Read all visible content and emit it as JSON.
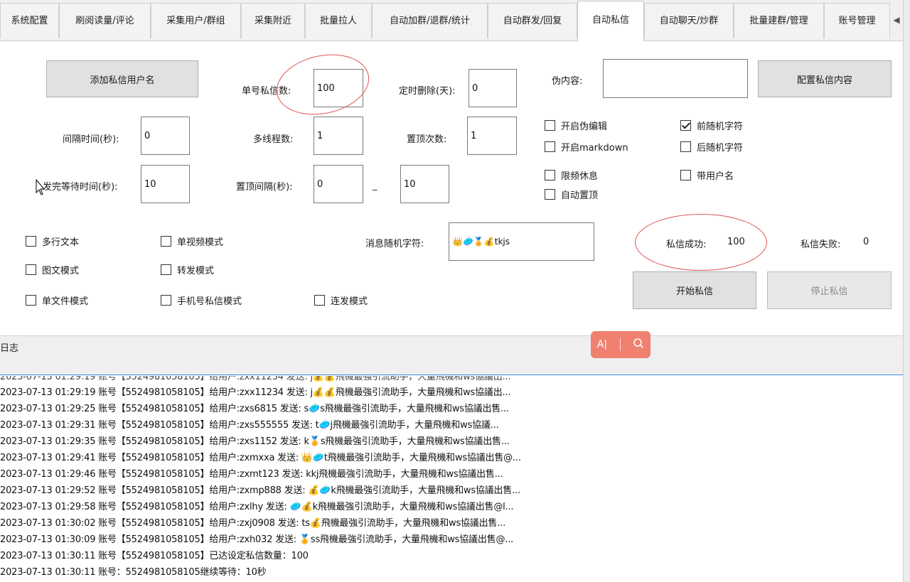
{
  "tabs": [
    {
      "label": "系统配置"
    },
    {
      "label": "刷阅读量/评论"
    },
    {
      "label": "采集用户/群组"
    },
    {
      "label": "采集附近"
    },
    {
      "label": "批量拉人"
    },
    {
      "label": "自动加群/退群/统计"
    },
    {
      "label": "自动群发/回复"
    },
    {
      "label": "自动私信"
    },
    {
      "label": "自动聊天/炒群"
    },
    {
      "label": "批量建群/管理"
    },
    {
      "label": "账号管理"
    }
  ],
  "active_tab": "自动私信",
  "form": {
    "add_user_button": "添加私信用户名",
    "per_account_label": "单号私信数:",
    "per_account_value": "100",
    "timed_delete_label": "定时删除(天):",
    "timed_delete_value": "0",
    "fake_content_label": "伪内容:",
    "fake_content_value": "",
    "config_content_button": "配置私信内容",
    "interval_label": "间隔时间(秒):",
    "interval_value": "0",
    "threads_label": "多线程数:",
    "threads_value": "1",
    "pin_count_label": "置顶次数:",
    "pin_count_value": "1",
    "wait_label": "发完等待时间(秒):",
    "wait_value": "10",
    "pin_interval_label": "置顶间隔(秒):",
    "pin_interval_min": "0",
    "pin_interval_dash": "_",
    "pin_interval_max": "10",
    "random_chars_label": "消息随机字符:",
    "random_chars_value": "👑🥏🏅💰tkjs",
    "success_label": "私信成功:",
    "success_value": "100",
    "fail_label": "私信失败:",
    "fail_value": "0",
    "start_button": "开始私信",
    "stop_button": "停止私信"
  },
  "checkboxes": {
    "fake_edit": {
      "label": "开启伪编辑",
      "checked": false
    },
    "markdown": {
      "label": "开启markdown",
      "checked": false
    },
    "rate_limit_rest": {
      "label": "限频休息",
      "checked": false
    },
    "auto_pin": {
      "label": "自动置顶",
      "checked": false
    },
    "prefix_random": {
      "label": "前随机字符",
      "checked": true
    },
    "suffix_random": {
      "label": "后随机字符",
      "checked": false
    },
    "with_username": {
      "label": "带用户名",
      "checked": false
    },
    "multiline_text": {
      "label": "多行文本",
      "checked": false
    },
    "image_text_mode": {
      "label": "图文模式",
      "checked": false
    },
    "single_file_mode": {
      "label": "单文件模式",
      "checked": false
    },
    "single_video_mode": {
      "label": "单视频模式",
      "checked": false
    },
    "forward_mode": {
      "label": "转发模式",
      "checked": false
    },
    "phone_dm_mode": {
      "label": "手机号私信模式",
      "checked": false
    },
    "burst_mode": {
      "label": "连发模式",
      "checked": false
    }
  },
  "log": {
    "title": "日志",
    "lines": [
      "2023-07-13 01:29:19 账号【5524981058105】给用户:zxx11234 发送: j💰💰飛機最強引流助手，大量飛機和ws協議出...",
      "2023-07-13 01:29:25 账号【5524981058105】给用户:zxs6815 发送: s🥏s飛機最強引流助手，大量飛機和ws協議出售...",
      "2023-07-13 01:29:31 账号【5524981058105】给用户:zxs555555 发送: t🥏j飛機最強引流助手，大量飛機和ws協議...",
      "2023-07-13 01:29:35 账号【5524981058105】给用户:zxs1152 发送: k🏅s飛機最強引流助手，大量飛機和ws協議出售...",
      "2023-07-13 01:29:41 账号【5524981058105】给用户:zxmxxa 发送: 👑🥏t飛機最強引流助手，大量飛機和ws協議出售@...",
      "2023-07-13 01:29:46 账号【5524981058105】给用户:zxmt123 发送: kkj飛機最強引流助手，大量飛機和ws協議出售...",
      "2023-07-13 01:29:52 账号【5524981058105】给用户:zxmp888 发送: 💰🥏k飛機最強引流助手，大量飛機和ws協議出售...",
      "2023-07-13 01:29:58 账号【5524981058105】给用户:zxlhy 发送: 🥏💰k飛機最強引流助手，大量飛機和ws協議出售@l...",
      "2023-07-13 01:30:02 账号【5524981058105】给用户:zxj0908 发送: ts💰飛機最強引流助手，大量飛機和ws協議出售...",
      "2023-07-13 01:30:09 账号【5524981058105】给用户:zxh032 发送: 🏅ss飛機最強引流助手，大量飛機和ws協議出售@...",
      "2023-07-13 01:30:11 账号【5524981058105】已达设定私信数量：100",
      "2023-07-13 01:30:11 账号：5524981058105继续等待：10秒"
    ]
  },
  "ocr_widget": {
    "text_icon": "A|",
    "search_icon": "search-icon"
  },
  "colors": {
    "annotation": "#e05050",
    "accent": "#3a8ee6",
    "ocr_widget": "#f08070"
  }
}
